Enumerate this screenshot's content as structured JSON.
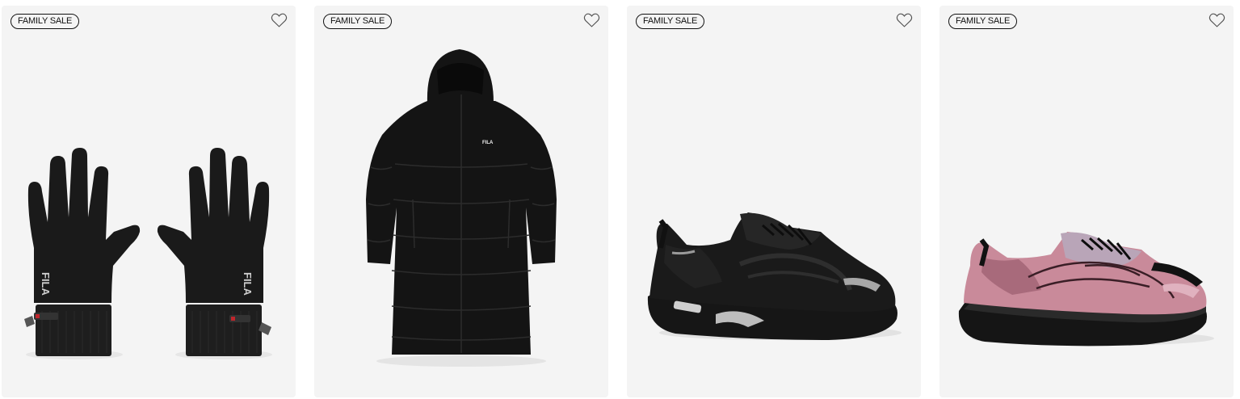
{
  "products": [
    {
      "badge": "FAMILY SALE",
      "image": "fleece-gloves",
      "wishlist_icon": "heart-outline-icon"
    },
    {
      "badge": "FAMILY SALE",
      "image": "long-puffer-coat",
      "wishlist_icon": "heart-outline-icon"
    },
    {
      "badge": "FAMILY SALE",
      "image": "black-chunky-sneaker",
      "wishlist_icon": "heart-outline-icon"
    },
    {
      "badge": "FAMILY SALE",
      "image": "pink-chunky-sneaker",
      "wishlist_icon": "heart-outline-icon"
    }
  ],
  "brand_mark": "FILA",
  "colors": {
    "card_bg": "#f4f4f4",
    "product_black": "#141414",
    "sneaker_pink": "#c98a9a"
  }
}
